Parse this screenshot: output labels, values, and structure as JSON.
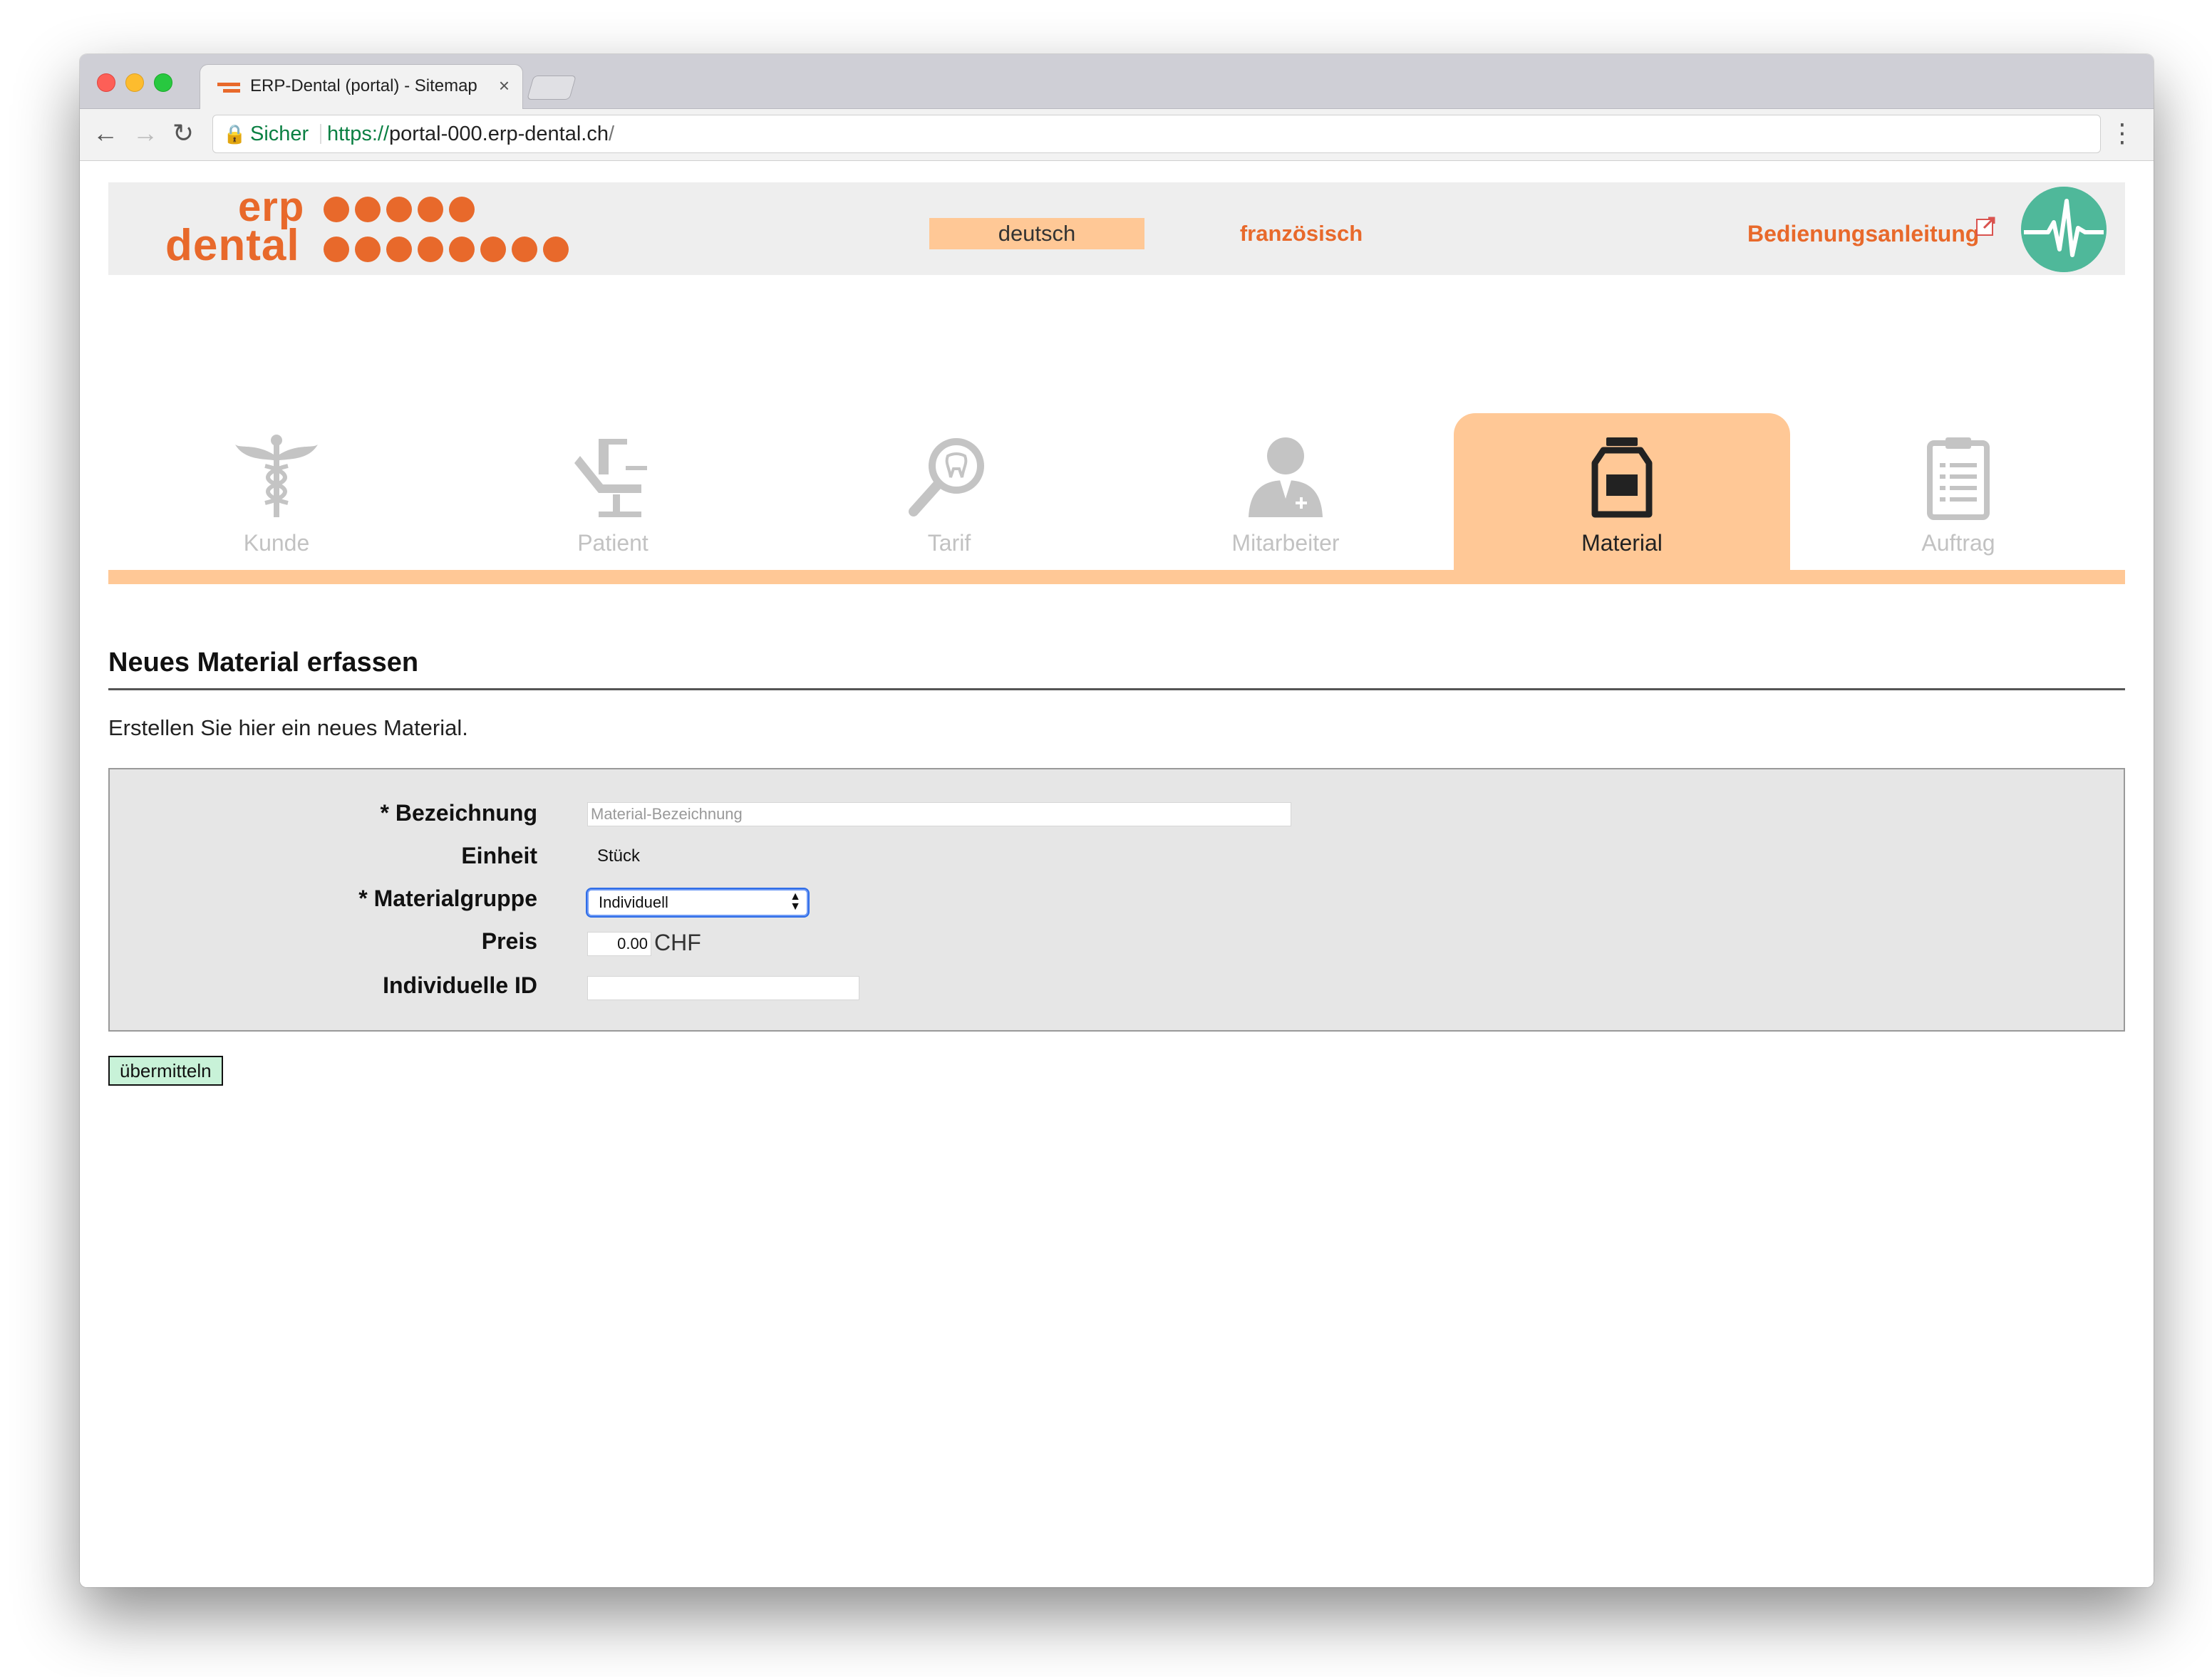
{
  "browser": {
    "tab_title": "ERP-Dental (portal) - Sitemap",
    "tab_close": "×",
    "secure_label": "Sicher",
    "url_scheme": "https://",
    "url_host": "portal-000.erp-dental.ch",
    "url_path": "/"
  },
  "header": {
    "logo_word1": "erp",
    "logo_word2": "dental",
    "lang_de": "deutsch",
    "lang_fr": "französisch",
    "manual": "Bedienungsanleitung",
    "accent_color": "#e8692b",
    "active_bg": "#ffc896",
    "pulse_color": "#4fb89a"
  },
  "modules": [
    {
      "label": "Kunde",
      "icon": "caduceus-icon",
      "active": false
    },
    {
      "label": "Patient",
      "icon": "dental-chair-icon",
      "active": false
    },
    {
      "label": "Tarif",
      "icon": "tooth-magnifier-icon",
      "active": false
    },
    {
      "label": "Mitarbeiter",
      "icon": "doctor-icon",
      "active": false
    },
    {
      "label": "Material",
      "icon": "material-jar-icon",
      "active": true
    },
    {
      "label": "Auftrag",
      "icon": "clipboard-icon",
      "active": false
    }
  ],
  "content": {
    "heading": "Neues Material erfassen",
    "intro": "Erstellen Sie hier ein neues Material."
  },
  "form": {
    "bezeichnung_label": "* Bezeichnung",
    "bezeichnung_placeholder": "Material-Bezeichnung",
    "einheit_label": "Einheit",
    "einheit_value": "Stück",
    "materialgruppe_label": "* Materialgruppe",
    "materialgruppe_value": "Individuell",
    "preis_label": "Preis",
    "preis_value": "0.00",
    "preis_currency": "CHF",
    "individuelle_id_label": "Individuelle ID",
    "individuelle_id_value": "",
    "submit_label": "übermitteln"
  }
}
